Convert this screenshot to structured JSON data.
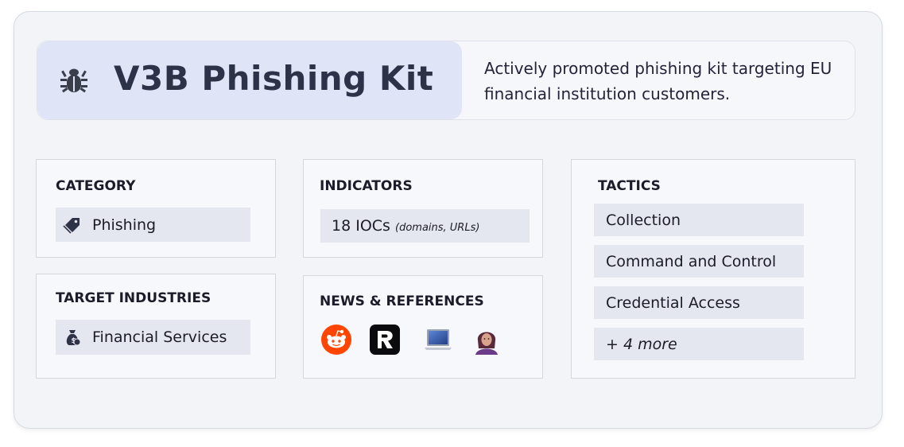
{
  "header": {
    "title": "V3B Phishing Kit",
    "icon": "bug-icon",
    "description": "Actively promoted phishing kit targeting EU financial institution customers."
  },
  "category": {
    "heading": "CATEGORY",
    "value": "Phishing",
    "icon": "tag-icon"
  },
  "target_industries": {
    "heading": "TARGET INDUSTRIES",
    "value": "Financial Services",
    "icon": "money-bag-icon"
  },
  "indicators": {
    "heading": "INDICATORS",
    "count_text": "18 IOCs",
    "detail": "(domains, URLs)"
  },
  "news": {
    "heading": "NEWS & REFERENCES",
    "sources": [
      "reddit-icon",
      "r-logo-icon",
      "laptop-icon",
      "person-avatar-icon"
    ]
  },
  "tactics": {
    "heading": "TACTICS",
    "items": [
      "Collection",
      "Command and Control",
      "Credential Access"
    ],
    "more": "+ 4 more"
  },
  "colors": {
    "card_bg": "#f3f4f8",
    "title_box": "#dfe4f6",
    "pill_bg": "#e4e7ef",
    "title_text": "#2c3248",
    "reddit": "#ff4500"
  }
}
